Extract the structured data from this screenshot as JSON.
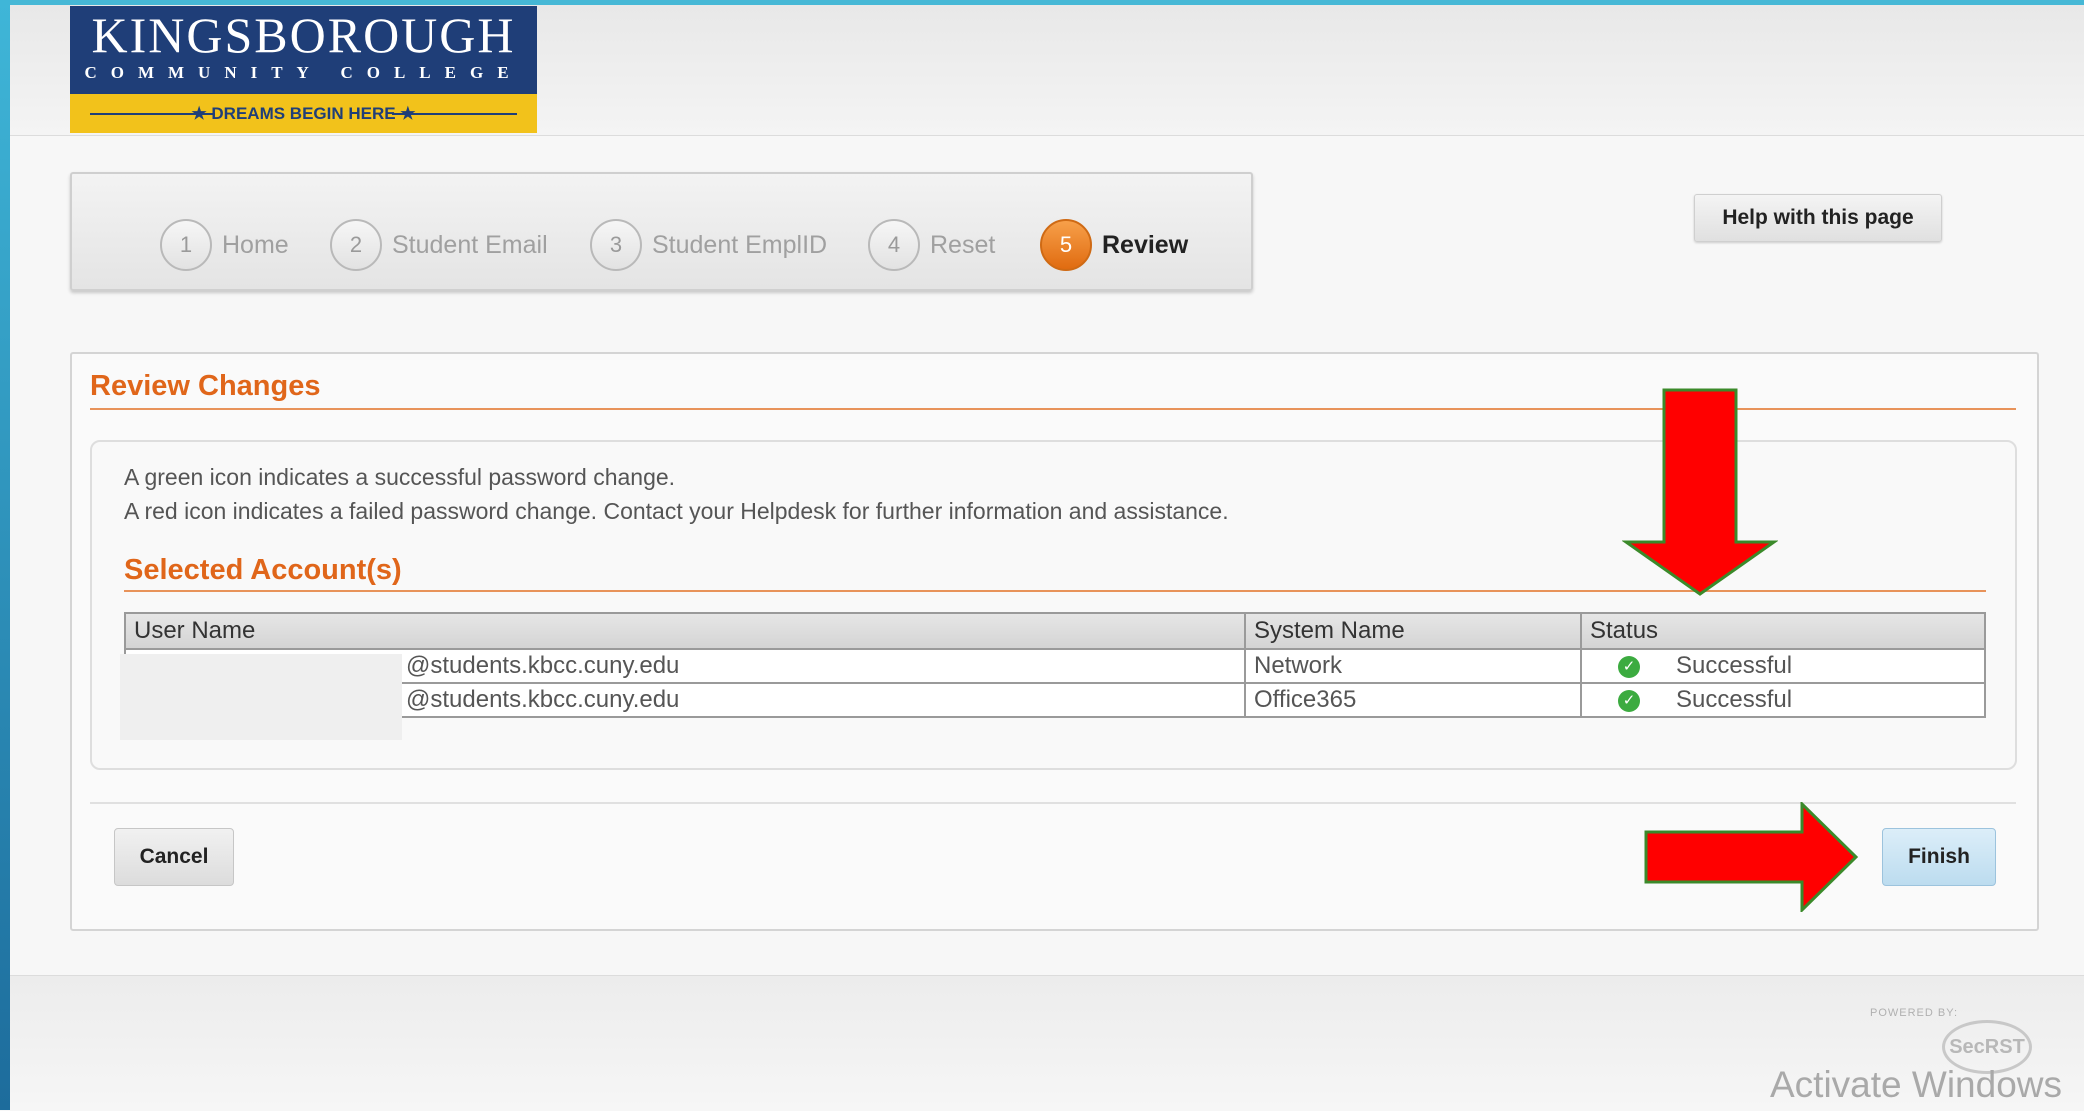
{
  "logo": {
    "name": "KINGSBOROUGH",
    "subtitle": "COMMUNITY COLLEGE",
    "tagline": "★ DREAMS BEGIN HERE ★"
  },
  "wizard": {
    "steps": [
      {
        "num": "1",
        "label": "Home"
      },
      {
        "num": "2",
        "label": "Student Email"
      },
      {
        "num": "3",
        "label": "Student EmplID"
      },
      {
        "num": "4",
        "label": "Reset"
      },
      {
        "num": "5",
        "label": "Review"
      }
    ],
    "active_step": 5
  },
  "help_button": "Help with this page",
  "panel": {
    "title": "Review Changes",
    "info_line1": "A green icon indicates a successful password change.",
    "info_line2": "A red icon indicates a failed password change. Contact your Helpdesk for further information and assistance.",
    "selected_title": "Selected Account(s)",
    "table": {
      "headers": [
        "User Name",
        "System Name",
        "Status"
      ],
      "rows": [
        {
          "user": "@students.kbcc.cuny.edu",
          "system": "Network",
          "status": "Successful"
        },
        {
          "user": "@students.kbcc.cuny.edu",
          "system": "Office365",
          "status": "Successful"
        }
      ]
    },
    "cancel_label": "Cancel",
    "finish_label": "Finish"
  },
  "footer": {
    "powered_by": "POWERED BY:",
    "brand_mark": "SecRST",
    "watermark": "Activate Windows"
  },
  "colors": {
    "accent": "#e0661a",
    "step_active": "#e8781a",
    "success": "#3cab40",
    "annotation_arrow": "#ff0000"
  },
  "icons": {
    "status_ok": "check-circle-icon",
    "annotation": "red-arrow-icon"
  }
}
